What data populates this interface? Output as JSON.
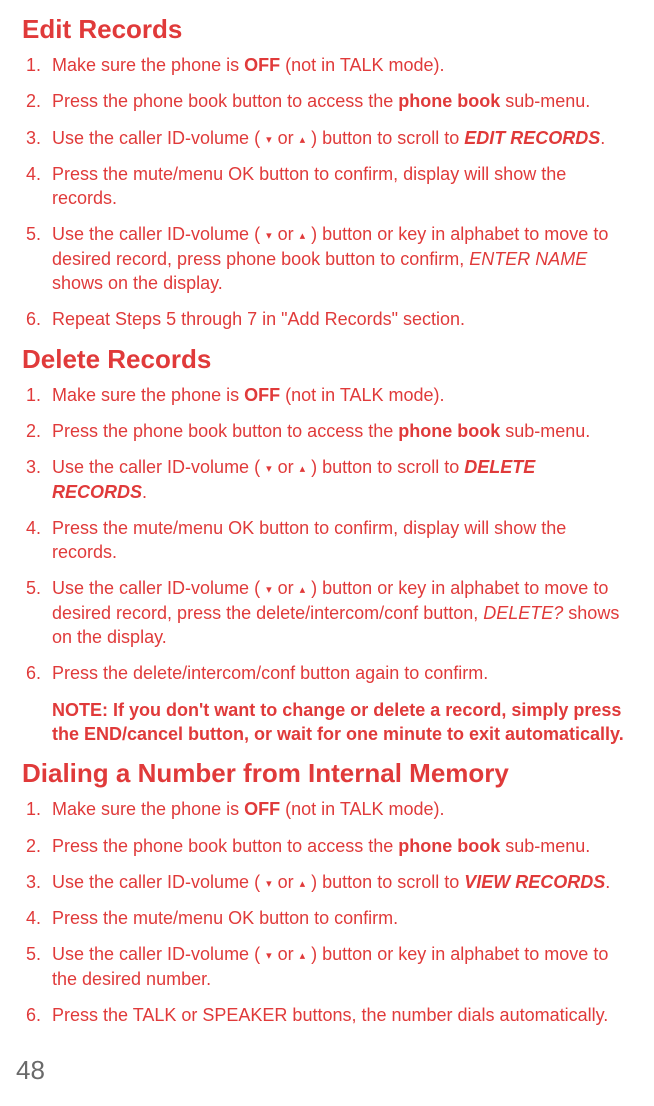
{
  "sections": [
    {
      "title": "Edit Records",
      "steps": [
        {
          "pre": "Make sure the phone is ",
          "bold": "OFF",
          "post": " (not in TALK mode)."
        },
        {
          "pre": "Press the phone book button to access the ",
          "bold": "phone book",
          "post": " sub-menu."
        },
        {
          "pre": "Use the caller ID-volume ( ",
          "arrows": true,
          "mid": " ) button to scroll to ",
          "bolditalic": "EDIT RECORDS",
          "post": "."
        },
        {
          "text": "Press the mute/menu OK button to confirm, display will show the records."
        },
        {
          "pre": "Use the caller ID-volume ( ",
          "arrows": true,
          "mid": " ) button or key in alphabet to move to desired record, press phone book button to confirm, ",
          "italic": "ENTER NAME",
          "post": " shows on the display."
        },
        {
          "text": "Repeat Steps 5 through 7 in \"Add Records\" section."
        }
      ]
    },
    {
      "title": "Delete Records",
      "steps": [
        {
          "pre": "Make sure the phone is ",
          "bold": "OFF",
          "post": " (not in TALK mode)."
        },
        {
          "pre": "Press the phone book button to access the ",
          "bold": "phone book",
          "post": " sub-menu."
        },
        {
          "pre": "Use the caller ID-volume ( ",
          "arrows": true,
          "mid": " ) button to scroll to ",
          "bolditalic": "DELETE RECORDS",
          "post": "."
        },
        {
          "text": "Press the mute/menu OK button to confirm, display will show the records."
        },
        {
          "pre": "Use the caller ID-volume ( ",
          "arrows": true,
          "mid": " ) button or key in alphabet to move to desired record, press the delete/intercom/conf button, ",
          "italic": "DELETE?",
          "post": " shows on the display."
        },
        {
          "text": "Press the delete/intercom/conf button again to confirm."
        }
      ],
      "note": "NOTE: If you don't want to change or delete a record, simply press the END/cancel button, or wait for one minute to exit automatically."
    },
    {
      "title": "Dialing a Number from Internal Memory",
      "big": true,
      "steps": [
        {
          "pre": "Make sure the phone is ",
          "bold": "OFF",
          "post": " (not in TALK mode)."
        },
        {
          "pre": "Press the phone book button to access the ",
          "bold": "phone book",
          "post": " sub-menu."
        },
        {
          "pre": "Use the caller ID-volume ( ",
          "arrows": true,
          "mid": " ) button to scroll to ",
          "bolditalic": "VIEW RECORDS",
          "post": "."
        },
        {
          "text": "Press the mute/menu OK button to confirm."
        },
        {
          "pre": "Use the caller ID-volume ( ",
          "arrows": true,
          "mid": " ) button or key in alphabet to move to the desired number.",
          "post": ""
        },
        {
          "text": "Press the TALK or SPEAKER buttons, the number dials automatically."
        }
      ]
    }
  ],
  "arrows": {
    "down": "▾",
    "or": " or ",
    "up": "▴"
  },
  "page_number": "48"
}
